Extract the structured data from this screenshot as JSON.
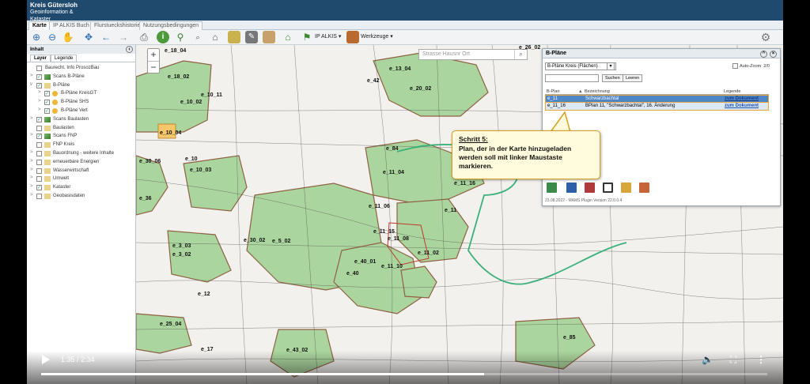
{
  "app": {
    "logo_title": "Kreis Gütersloh",
    "logo_subtitle": "Geoinformation & Kataster"
  },
  "tabs": [
    {
      "label": "Karte",
      "active": true
    },
    {
      "label": "IP ALKIS Buch",
      "active": false
    },
    {
      "label": "Flurstueckshistorie",
      "active": false
    },
    {
      "label": "Nutzungsbedingungen",
      "active": false
    }
  ],
  "toolbar": {
    "ip_alkis_label": "IP ALKIS",
    "werkzeuge_label": "Werkzeuge"
  },
  "sidebar": {
    "title": "Inhalt",
    "tabs": [
      "Layer",
      "Legende"
    ],
    "layers": [
      {
        "label": "Baurecht. Info ProsozBau",
        "checked": false,
        "expand": "",
        "indent": 0,
        "icon": ""
      },
      {
        "label": "Scans B-Pläne",
        "checked": true,
        "expand": ">",
        "indent": 0,
        "icon": "raster-icon"
      },
      {
        "label": "B-Pläne",
        "checked": true,
        "expand": "v",
        "indent": 0,
        "icon": "folder-icon"
      },
      {
        "label": "B-Pläne KreisGT",
        "checked": true,
        "expand": ">",
        "indent": 1,
        "icon": "circle-icon"
      },
      {
        "label": "B-Pläne SHS",
        "checked": true,
        "expand": ">",
        "indent": 1,
        "icon": "circle-icon"
      },
      {
        "label": "B-Pläne Vert",
        "checked": true,
        "expand": ">",
        "indent": 1,
        "icon": "circle-icon"
      },
      {
        "label": "Scans Baulasten",
        "checked": true,
        "expand": ">",
        "indent": 0,
        "icon": "raster-icon"
      },
      {
        "label": "Baulasten",
        "checked": false,
        "expand": "",
        "indent": 0,
        "icon": "folder-icon"
      },
      {
        "label": "Scans FNP",
        "checked": true,
        "expand": ">",
        "indent": 0,
        "icon": "raster-icon"
      },
      {
        "label": "FNP Kreis",
        "checked": false,
        "expand": "",
        "indent": 0,
        "icon": "folder-icon"
      },
      {
        "label": "Bauordnung - weitere Inhalte",
        "checked": false,
        "expand": ">",
        "indent": 0,
        "icon": "folder-icon"
      },
      {
        "label": "erneuerbare Energien",
        "checked": false,
        "expand": ">",
        "indent": 0,
        "icon": "folder-icon"
      },
      {
        "label": "Wasserwirtschaft",
        "checked": false,
        "expand": ">",
        "indent": 0,
        "icon": "folder-icon"
      },
      {
        "label": "Umwelt",
        "checked": false,
        "expand": ">",
        "indent": 0,
        "icon": "folder-icon"
      },
      {
        "label": "Kataster",
        "checked": true,
        "expand": ">",
        "indent": 0,
        "icon": "folder-icon"
      },
      {
        "label": "Geobasisdaten",
        "checked": false,
        "expand": ">",
        "indent": 0,
        "icon": "folder-icon"
      }
    ]
  },
  "map": {
    "search_placeholder": "Strasse  Hausnr  Ort",
    "labels": [
      "e_18_04",
      "e_18_02",
      "e_10_02",
      "e_10_11",
      "e_10_04",
      "e_10",
      "e_10_03",
      "e_30_06",
      "e_36",
      "e_42",
      "e_13_04",
      "e_20_02",
      "e_26_02",
      "e_84",
      "e_11_04",
      "e_11_16",
      "e_11_06",
      "e_11",
      "e_11_15",
      "e_11_08",
      "e_11_02",
      "e_11_10",
      "e_40_01",
      "e_40",
      "e_30_02",
      "e_5_02",
      "e_3_03",
      "e_3_02",
      "e_12",
      "e_25_04",
      "e_17",
      "e_43_02",
      "e_85"
    ]
  },
  "panel": {
    "title": "B-Pläne",
    "select_value": "B-Pläne Kreis (Flächen)",
    "autozoom_label": "Auto-Zoom",
    "count": "2/0",
    "search_button": "Suchen",
    "clear_button": "Leeren",
    "columns": [
      "B-Plan",
      "Bezeichnung",
      "Legende"
    ],
    "rows": [
      {
        "plan": "e_11",
        "bezeichnung": "Schwarzbachtal",
        "legende": "zum Dokument"
      },
      {
        "plan": "e_11_16",
        "bezeichnung": "BPlan 11, \"Schwarzbachtal\", 16. Änderung",
        "legende": "zum Dokument"
      }
    ],
    "footer": "23.08.2022 - MAMS Plugin Version 22.0.0.4"
  },
  "callout": {
    "step": "Schritt 5:",
    "text": "Plan, der in der Karte hinzugeladen werden soll mit linker Maustaste markieren."
  },
  "video": {
    "time": "1:35 / 2:34",
    "progress": 0.61
  },
  "colors": {
    "header": "#1f4a6e",
    "highlight": "#e9a53a",
    "selected_row": "#4f86c6",
    "plan_area": "#a8d49a"
  }
}
